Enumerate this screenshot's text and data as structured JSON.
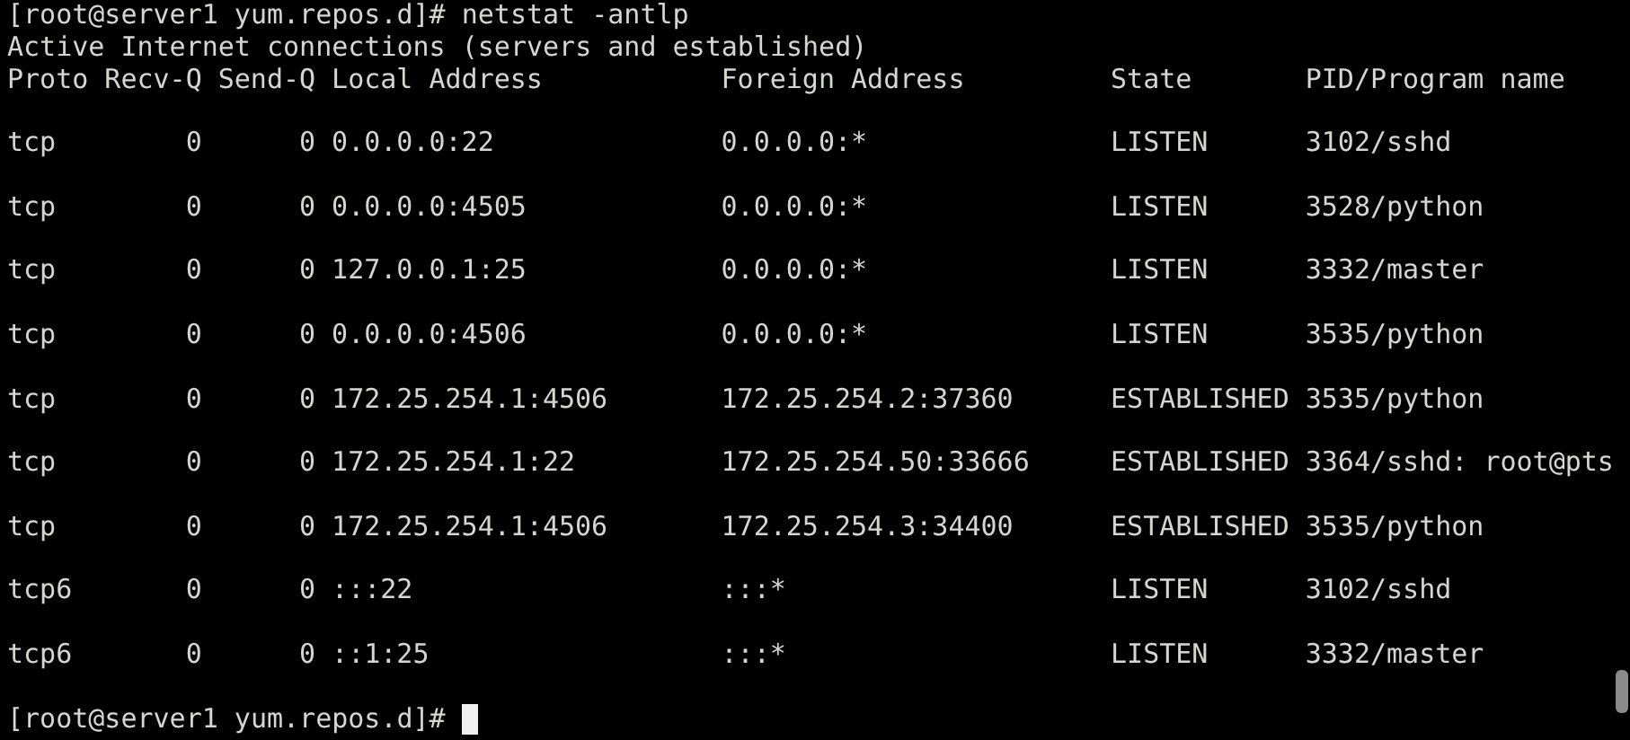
{
  "prompt_line": {
    "prompt": "[root@server1 yum.repos.d]#",
    "command": "netstat -antlp"
  },
  "intro": "Active Internet connections (servers and established)",
  "columns": [
    "Proto",
    "Recv-Q",
    "Send-Q",
    "Local Address",
    "Foreign Address",
    "State",
    "PID/Program name"
  ],
  "rows": [
    [
      "tcp",
      "0",
      "0",
      "0.0.0.0:22",
      "0.0.0.0:*",
      "LISTEN",
      "3102/sshd"
    ],
    [
      "tcp",
      "0",
      "0",
      "0.0.0.0:4505",
      "0.0.0.0:*",
      "LISTEN",
      "3528/python"
    ],
    [
      "tcp",
      "0",
      "0",
      "127.0.0.1:25",
      "0.0.0.0:*",
      "LISTEN",
      "3332/master"
    ],
    [
      "tcp",
      "0",
      "0",
      "0.0.0.0:4506",
      "0.0.0.0:*",
      "LISTEN",
      "3535/python"
    ],
    [
      "tcp",
      "0",
      "0",
      "172.25.254.1:4506",
      "172.25.254.2:37360",
      "ESTABLISHED",
      "3535/python"
    ],
    [
      "tcp",
      "0",
      "0",
      "172.25.254.1:22",
      "172.25.254.50:33666",
      "ESTABLISHED",
      "3364/sshd: root@pts"
    ],
    [
      "tcp",
      "0",
      "0",
      "172.25.254.1:4506",
      "172.25.254.3:34400",
      "ESTABLISHED",
      "3535/python"
    ],
    [
      "tcp6",
      "0",
      "0",
      ":::22",
      ":::*",
      "LISTEN",
      "3102/sshd"
    ],
    [
      "tcp6",
      "0",
      "0",
      "::1:25",
      ":::*",
      "LISTEN",
      "3332/master"
    ]
  ],
  "final_prompt": {
    "prompt": "[root@server1 yum.repos.d]#"
  }
}
